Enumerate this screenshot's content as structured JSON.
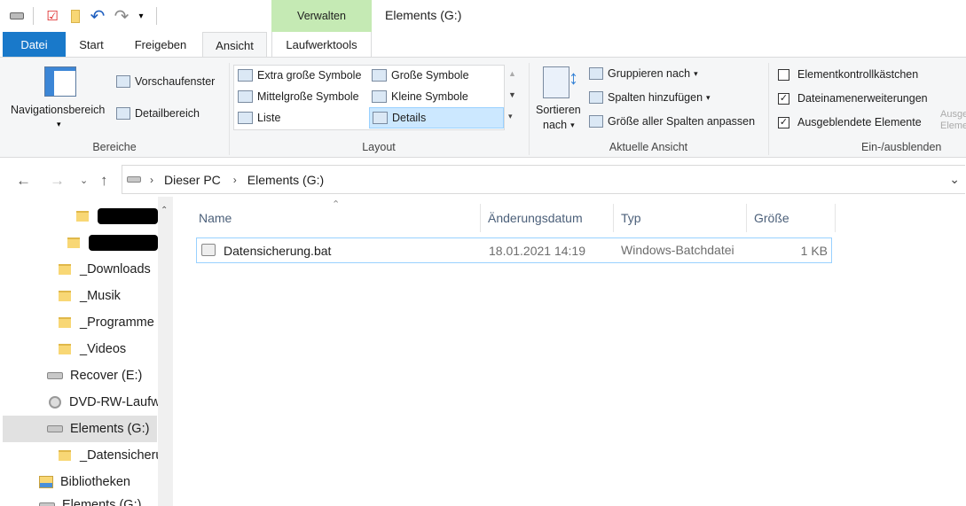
{
  "titlebar": {
    "context_tab": "Verwalten",
    "window_title": "Elements (G:)"
  },
  "tabs": {
    "datei": "Datei",
    "start": "Start",
    "freigeben": "Freigeben",
    "ansicht": "Ansicht",
    "laufwerktools": "Laufwerktools"
  },
  "ribbon": {
    "bereiche": {
      "navigationsbereich": "Navigationsbereich",
      "vorschaufenster": "Vorschaufenster",
      "detailbereich": "Detailbereich",
      "group_label": "Bereiche"
    },
    "layout": {
      "items": [
        "Extra große Symbole",
        "Große Symbole",
        "Mittelgroße Symbole",
        "Kleine Symbole",
        "Liste",
        "Details"
      ],
      "selected": "Details",
      "group_label": "Layout"
    },
    "aktuelle_ansicht": {
      "sortieren": "Sortieren",
      "nach": "nach",
      "gruppieren": "Gruppieren nach",
      "spalten_hinzufuegen": "Spalten hinzufügen",
      "groesse_anpassen": "Größe aller Spalten anpassen",
      "group_label": "Aktuelle Ansicht"
    },
    "ein_ausblenden": {
      "items": [
        {
          "label": "Elementkontrollkästchen",
          "checked": false
        },
        {
          "label": "Dateinamenerweiterungen",
          "checked": true
        },
        {
          "label": "Ausgeblendete Elemente",
          "checked": true
        }
      ],
      "group_label": "Ein-/ausblenden",
      "cut_label": "Ausgewählte Elemente",
      "cut_label2": "Eleme"
    }
  },
  "address": {
    "crumbs": [
      "Dieser PC",
      "Elements (G:)"
    ]
  },
  "navpane": {
    "items": [
      {
        "label": "",
        "type": "folder-redacted"
      },
      {
        "label": "",
        "type": "folder-redacted"
      },
      {
        "label": "_Downloads",
        "type": "folder"
      },
      {
        "label": "_Musik",
        "type": "folder"
      },
      {
        "label": "_Programme",
        "type": "folder"
      },
      {
        "label": "_Videos",
        "type": "folder"
      },
      {
        "label": "Recover (E:)",
        "type": "drive"
      },
      {
        "label": "DVD-RW-Laufwerk",
        "type": "dvd"
      },
      {
        "label": "Elements (G:)",
        "type": "drive",
        "selected": true
      },
      {
        "label": "_Datensicherung",
        "type": "folder"
      },
      {
        "label": "Bibliotheken",
        "type": "library"
      },
      {
        "label": "Elements (G:)",
        "type": "drive"
      }
    ]
  },
  "filelist": {
    "columns": [
      "Name",
      "Änderungsdatum",
      "Typ",
      "Größe"
    ],
    "rows": [
      {
        "name": "Datensicherung.bat",
        "date": "18.01.2021 14:19",
        "type": "Windows-Batchdatei",
        "size": "1 KB"
      }
    ]
  }
}
